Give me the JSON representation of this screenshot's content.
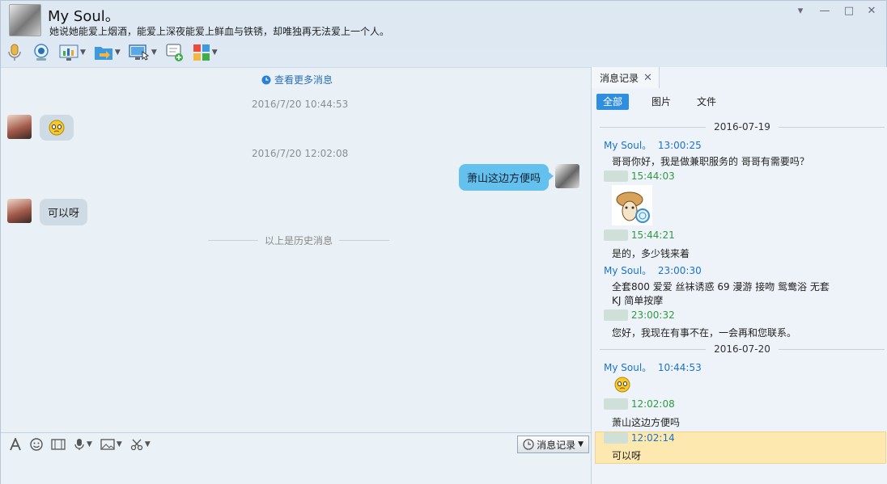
{
  "header": {
    "name": "My Soul。",
    "signature": "她说她能爱上烟酒，能爱上深夜能爱上鲜血与铁锈，却唯独再无法爱上一个人。",
    "window_controls": [
      "▾",
      "—",
      "□",
      "✕"
    ]
  },
  "chat": {
    "more_label": "查看更多消息",
    "ts1": "2016/7/20 10:44:53",
    "ts2": "2016/7/20 12:02:08",
    "msg_self": "萧山这边方便吗",
    "msg_reply": "可以呀",
    "history_label": "以上是历史消息"
  },
  "input_toolbar": {
    "history_btn": "消息记录"
  },
  "panel": {
    "tab_label": "消息记录",
    "filters": [
      "全部",
      "图片",
      "文件"
    ],
    "date1": "2016-07-19",
    "date2": "2016-07-20",
    "entries": {
      "e1_name": "My Soul。",
      "e1_time": "13:00:25",
      "e1_text": "哥哥你好，我是做兼职服务的  哥哥有需要吗？",
      "e2_time": "15:44:03",
      "e3_time": "15:44:21",
      "e3_text": "是的，多少钱来着",
      "e4_name": "My Soul。",
      "e4_time": "23:00:30",
      "e4_text": "全套800  爱爱  丝袜诱惑  69  漫游  接吻  鸳鸯浴  无套",
      "e4_text2": "KJ  简单按摩",
      "e5_time": "23:00:32",
      "e5_text": "您好，我现在有事不在，一会再和您联系。",
      "e6_name": "My Soul。",
      "e6_time": "10:44:53",
      "e7_time": "12:02:08",
      "e7_text": "萧山这边方便吗",
      "e8_time": "12:02:14",
      "e8_text": "可以呀"
    }
  },
  "colors": {
    "accent": "#2f8ee0",
    "self_bubble": "#64c1ee",
    "peer_bubble": "#cfdbe4",
    "name_blue": "#1b73c9",
    "name_green": "#2e9a43",
    "highlight": "#fde8b0"
  }
}
